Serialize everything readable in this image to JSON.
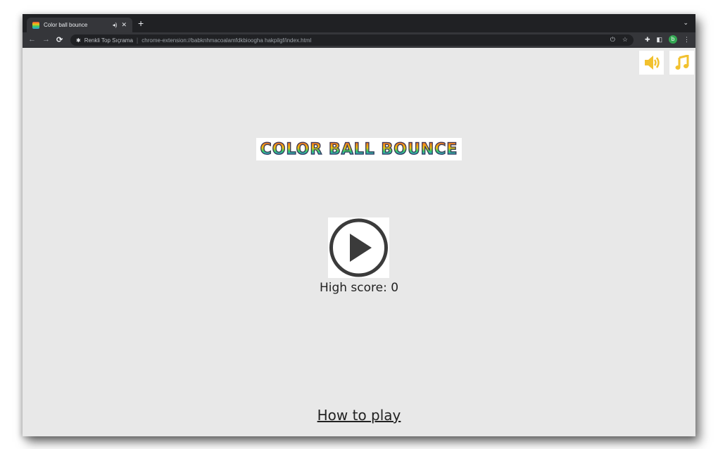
{
  "browser": {
    "tab": {
      "title": "Color ball bounce",
      "audio_icon": "speaker-icon",
      "close_icon": "close-icon"
    },
    "new_tab_label": "+",
    "tab_menu_icon": "chevron-down-icon",
    "nav": {
      "back": "←",
      "forward": "→",
      "reload": "C"
    },
    "omnibox": {
      "site_name": "Renkli Top Sıçrama",
      "url": "chrome-extension://babknhmacoalamfdkbioogha hakpilgf/index.html",
      "share_icon": "share-icon",
      "bookmark_icon": "star-icon"
    },
    "toolbar": {
      "extensions_icon": "puzzle-icon",
      "sidepanel_icon": "side-panel-icon",
      "profile_initial": "b",
      "menu_icon": "kebab-menu-icon"
    }
  },
  "game": {
    "title": "COLOR BALL BOUNCE",
    "sound_button_icon": "speaker-icon",
    "music_button_icon": "music-note-icon",
    "play_button_icon": "play-icon",
    "high_score_label": "High score: 0",
    "how_to_play_label": "How to play",
    "accent_color": "#f2c12e"
  }
}
